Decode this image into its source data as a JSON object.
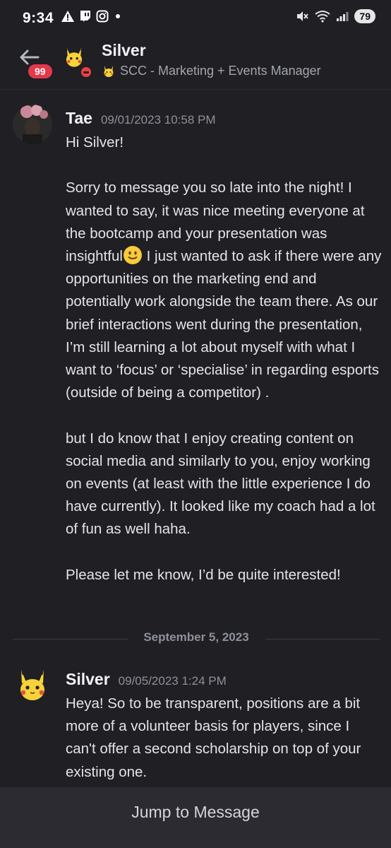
{
  "status_bar": {
    "time": "9:34",
    "battery": "79"
  },
  "header": {
    "title": "Silver",
    "status_text": "SCC - Marketing + Events Manager",
    "unread_badge": "99"
  },
  "messages": [
    {
      "author": "Tae",
      "timestamp": "09/01/2023 10:58 PM",
      "line_greeting": "Hi Silver!",
      "para1_before_emoji": "Sorry to message you so late into the night! I wanted to say, it was nice meeting everyone at the bootcamp and your presentation was insightful",
      "para1_after_emoji": " I just wanted to ask if there were any opportunities on the marketing end and potentially work alongside the team there. As our brief interactions went during the presentation, I’m still learning a lot about myself with what I want to ‘focus’ or ‘specialise’ in regarding esports (outside of being a competitor) .",
      "para2": "but I do know that I enjoy creating content on social media and similarly to you, enjoy working on events (at least with the little experience I do have currently). It looked like my coach had a lot of fun as well haha.",
      "para3": "Please let me know, I’d be quite interested!"
    },
    {
      "author": "Silver",
      "timestamp": "09/05/2023 1:24 PM",
      "text": "Heya! So to be transparent, positions are a bit more of a volunteer basis for players, since I can't offer a second scholarship on top of your existing one."
    }
  ],
  "date_divider": "September 5, 2023",
  "jump_button": "Jump to Message",
  "colors": {
    "background": "#1f1f24",
    "dnd_status": "#f23f43",
    "badge": "#e4394a",
    "footer": "#2b2b31"
  }
}
